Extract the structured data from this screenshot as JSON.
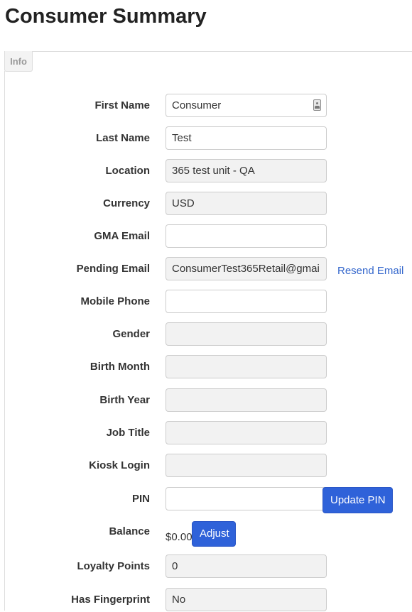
{
  "page": {
    "title": "Consumer Summary"
  },
  "tabs": [
    {
      "label": "Info"
    }
  ],
  "form": {
    "first_name": {
      "label": "First Name",
      "value": "Consumer",
      "icon": "contact-card-icon"
    },
    "last_name": {
      "label": "Last Name",
      "value": "Test"
    },
    "location": {
      "label": "Location",
      "value": "365 test unit - QA"
    },
    "currency": {
      "label": "Currency",
      "value": "USD"
    },
    "gma_email": {
      "label": "GMA Email",
      "value": ""
    },
    "pending_email": {
      "label": "Pending Email",
      "value": "ConsumerTest365Retail@gmai",
      "action": "Resend Email"
    },
    "mobile_phone": {
      "label": "Mobile Phone",
      "value": ""
    },
    "gender": {
      "label": "Gender",
      "value": ""
    },
    "birth_month": {
      "label": "Birth Month",
      "value": ""
    },
    "birth_year": {
      "label": "Birth Year",
      "value": ""
    },
    "job_title": {
      "label": "Job Title",
      "value": ""
    },
    "kiosk_login": {
      "label": "Kiosk Login",
      "value": ""
    },
    "pin": {
      "label": "PIN",
      "value": "",
      "action": "Update PIN"
    },
    "balance": {
      "label": "Balance",
      "value": "$0.00",
      "action": "Adjust"
    },
    "loyalty_points": {
      "label": "Loyalty Points",
      "value": "0"
    },
    "has_fingerprint": {
      "label": "Has Fingerprint",
      "value": "No"
    }
  },
  "colors": {
    "primary_button": "#2f62d9",
    "link": "#3366cc",
    "readonly_bg": "#f2f2f2"
  }
}
